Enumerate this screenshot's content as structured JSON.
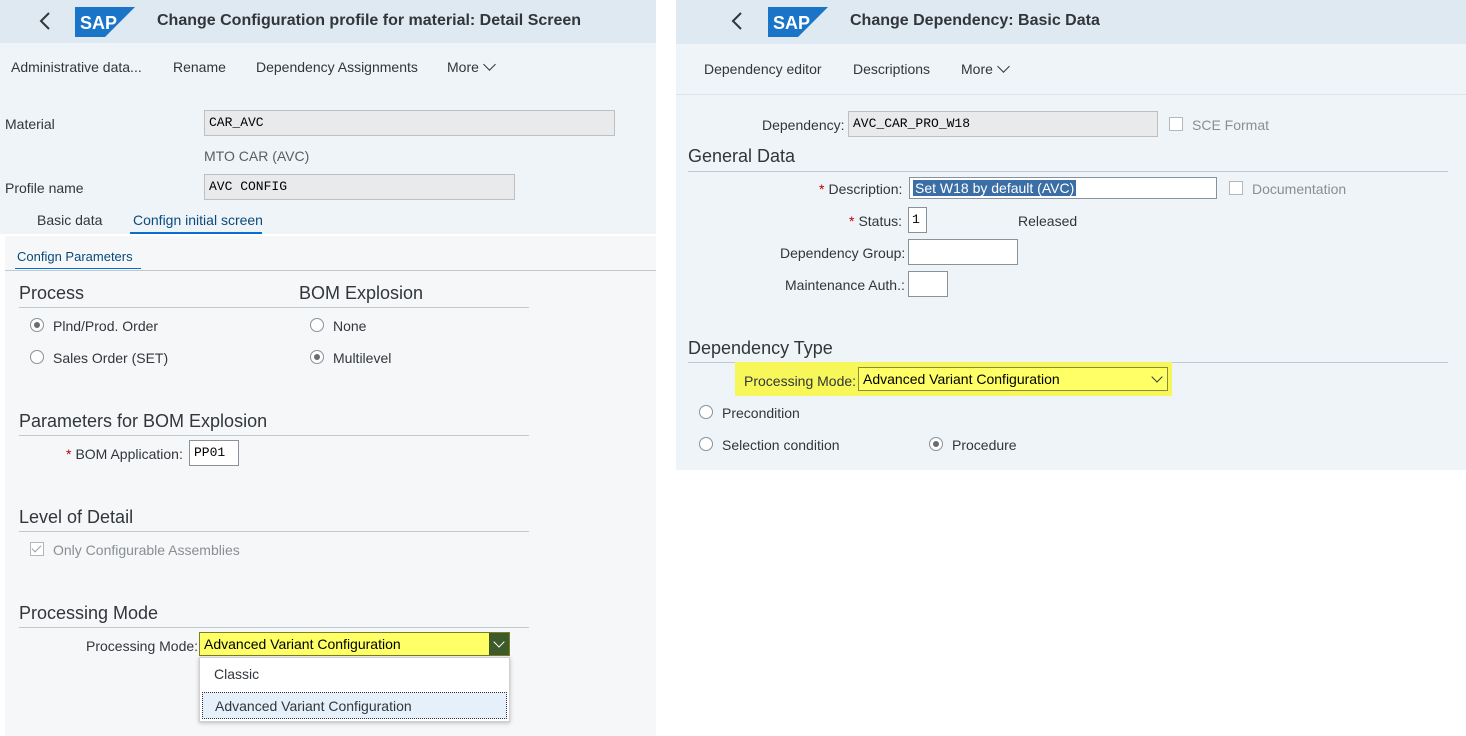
{
  "left": {
    "title": "Change Configuration profile for material: Detail Screen",
    "toolbar": {
      "admin": "Administrative data...",
      "rename": "Rename",
      "dep_assign": "Dependency Assignments",
      "more": "More"
    },
    "material_label": "Material",
    "material_value": "CAR_AVC",
    "material_desc": "MTO CAR (AVC)",
    "profile_label": "Profile name",
    "profile_value": "AVC CONFIG",
    "tabs": [
      "Basic data",
      "Confign initial screen"
    ],
    "subtab": "Confign Parameters",
    "process": {
      "title": "Process",
      "options": [
        "Plnd/Prod. Order",
        "Sales Order (SET)"
      ],
      "selected": "Plnd/Prod. Order"
    },
    "bom_explosion": {
      "title": "BOM Explosion",
      "options": [
        "None",
        "Multilevel"
      ],
      "selected": "Multilevel"
    },
    "params_title": "Parameters for BOM Explosion",
    "bom_app_label": "BOM Application:",
    "bom_app_value": "PP01",
    "level_title": "Level of Detail",
    "only_config_label": "Only Configurable Assemblies",
    "processing_title": "Processing Mode",
    "processing_label": "Processing Mode:",
    "processing_value": "Advanced Variant Configuration",
    "dropdown_options": [
      "Classic",
      "Advanced Variant Configuration"
    ],
    "dropdown_selected": "Advanced Variant Configuration"
  },
  "right": {
    "title": "Change Dependency: Basic Data",
    "toolbar": {
      "editor": "Dependency editor",
      "descriptions": "Descriptions",
      "more": "More"
    },
    "dependency_label": "Dependency:",
    "dependency_value": "AVC_CAR_PRO_W18",
    "sce_format": "SCE Format",
    "general_title": "General Data",
    "description_label": "Description:",
    "description_value": "Set W18 by default (AVC)",
    "documentation": "Documentation",
    "status_label": "Status:",
    "status_value": "1",
    "status_text": "Released",
    "dep_group_label": "Dependency Group:",
    "maint_auth_label": "Maintenance Auth.:",
    "dep_type_title": "Dependency Type",
    "processing_label": "Processing Mode:",
    "processing_value": "Advanced Variant Configuration",
    "types": [
      "Precondition",
      "Selection condition",
      "Procedure"
    ],
    "type_selected": "Procedure"
  },
  "colors": {
    "shell": "#dfe9f2",
    "toolbar": "#eff4f9",
    "highlight": "#ffff66",
    "sap_blue": "#0a6ed1"
  }
}
